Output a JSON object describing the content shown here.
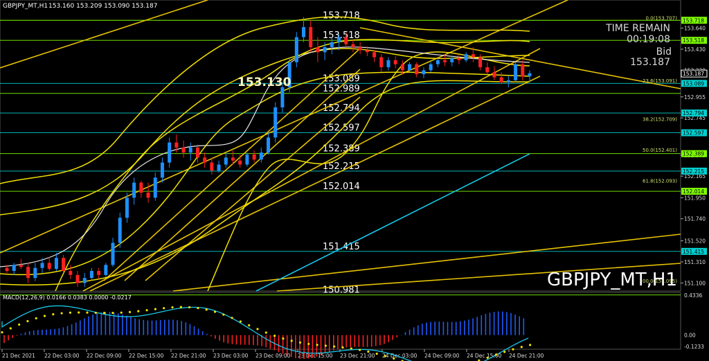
{
  "header": {
    "symbol_info": "GBPJPY_MT,H1",
    "ohlc": "153.160 153.209 153.090 153.187"
  },
  "watermark": "GBPJPY_MT,H1",
  "timer": {
    "label": "TIME REMAIN",
    "value": "00:19:08"
  },
  "bid": {
    "label": "Bid",
    "value": "153.187"
  },
  "high_label": "153.130",
  "h_levels": [
    {
      "value": "153.718",
      "color": "#7fff00"
    },
    {
      "value": "153.518",
      "color": "#7fff00"
    },
    {
      "value": "153.089",
      "color": "#00d0d0"
    },
    {
      "value": "152.989",
      "color": "#7fff00"
    },
    {
      "value": "152.794",
      "color": "#00d0d0"
    },
    {
      "value": "152.597",
      "color": "#00d0d0"
    },
    {
      "value": "152.389",
      "color": "#7fff00"
    },
    {
      "value": "152.215",
      "color": "#00d0d0"
    },
    {
      "value": "152.014",
      "color": "#7fff00"
    },
    {
      "value": "151.415",
      "color": "#00d0d0"
    },
    {
      "value": "150.981",
      "color": "#7fff00"
    }
  ],
  "fib_labels": [
    {
      "label": "0.0(153.707)",
      "price": 153.718
    },
    {
      "label": "23.6(153.091)",
      "price": 153.091
    },
    {
      "label": "38.2(152.709)",
      "price": 152.709
    },
    {
      "label": "50.0(152.401)",
      "price": 152.401
    },
    {
      "label": "61.8(152.093)",
      "price": 152.093
    },
    {
      "label": "100.0(151.095)",
      "price": 151.095
    }
  ],
  "price_axis": {
    "ticks": [
      "153.640",
      "153.430",
      "153.220",
      "152.955",
      "152.745",
      "152.375",
      "152.165",
      "151.950",
      "151.740",
      "151.520",
      "151.310",
      "151.100"
    ],
    "tick_values": [
      153.64,
      153.43,
      153.22,
      152.955,
      152.745,
      152.375,
      152.165,
      151.95,
      151.74,
      151.52,
      151.31,
      151.1
    ],
    "boxed": [
      {
        "label": "153.718",
        "color": "#7fff00"
      },
      {
        "label": "153.518",
        "color": "#7fff00"
      },
      {
        "label": "153.187",
        "color": "#ffffff"
      },
      {
        "label": "153.089",
        "color": "#00d0d0"
      },
      {
        "label": "152.794",
        "color": "#00d0d0"
      },
      {
        "label": "152.597",
        "color": "#00d0d0"
      },
      {
        "label": "152.389",
        "color": "#7fff00"
      },
      {
        "label": "152.215",
        "color": "#00d0d0"
      },
      {
        "label": "152.014",
        "color": "#7fff00"
      },
      {
        "label": "151.415",
        "color": "#00d0d0"
      }
    ]
  },
  "time_axis": [
    "21 Dec 2021",
    "22 Dec 03:00",
    "22 Dec 09:00",
    "22 Dec 15:00",
    "22 Dec 21:00",
    "23 Dec 03:00",
    "23 Dec 09:00",
    "23 Dec 15:00",
    "23 Dec 21:00",
    "24 Dec 03:00",
    "24 Dec 09:00",
    "24 Dec 15:00",
    "24 Dec 21:00"
  ],
  "macd": {
    "label": "MACD(12,26,9) 0.0166 0.0383 0.0000 -0.0217",
    "ticks": [
      "0.4336",
      "0.00",
      "-0.1233"
    ],
    "tick_values": [
      0.4336,
      0.0,
      -0.1233
    ]
  },
  "chart_data": {
    "type": "candlestick",
    "title": "GBPJPY_MT,H1",
    "ylim": [
      151.02,
      153.92
    ],
    "candles": [
      [
        151.25,
        151.28,
        151.2,
        151.22
      ],
      [
        151.22,
        151.3,
        151.18,
        151.28
      ],
      [
        151.28,
        151.34,
        151.24,
        151.26
      ],
      [
        151.26,
        151.3,
        151.1,
        151.15
      ],
      [
        151.15,
        151.3,
        151.12,
        151.25
      ],
      [
        151.25,
        151.35,
        151.2,
        151.3
      ],
      [
        151.3,
        151.36,
        151.22,
        151.24
      ],
      [
        151.24,
        151.4,
        151.22,
        151.35
      ],
      [
        151.35,
        151.38,
        151.2,
        151.22
      ],
      [
        151.22,
        151.28,
        151.14,
        151.18
      ],
      [
        151.18,
        151.22,
        151.06,
        151.1
      ],
      [
        151.1,
        151.2,
        151.06,
        151.15
      ],
      [
        151.15,
        151.25,
        151.12,
        151.22
      ],
      [
        151.22,
        151.25,
        151.14,
        151.18
      ],
      [
        151.18,
        151.3,
        151.16,
        151.28
      ],
      [
        151.28,
        151.55,
        151.26,
        151.5
      ],
      [
        151.5,
        151.8,
        151.45,
        151.75
      ],
      [
        151.75,
        152.0,
        151.7,
        151.95
      ],
      [
        151.95,
        152.15,
        151.88,
        152.1
      ],
      [
        152.1,
        152.12,
        151.95,
        152.0
      ],
      [
        152.0,
        152.1,
        151.9,
        151.95
      ],
      [
        151.95,
        152.2,
        151.92,
        152.15
      ],
      [
        152.15,
        152.35,
        152.1,
        152.3
      ],
      [
        152.3,
        152.55,
        152.25,
        152.5
      ],
      [
        152.5,
        152.58,
        152.4,
        152.45
      ],
      [
        152.45,
        152.52,
        152.35,
        152.4
      ],
      [
        152.4,
        152.5,
        152.32,
        152.45
      ],
      [
        152.45,
        152.48,
        152.3,
        152.35
      ],
      [
        152.35,
        152.4,
        152.25,
        152.3
      ],
      [
        152.3,
        152.35,
        152.18,
        152.22
      ],
      [
        152.22,
        152.32,
        152.2,
        152.28
      ],
      [
        152.28,
        152.4,
        152.25,
        152.35
      ],
      [
        152.35,
        152.42,
        152.28,
        152.32
      ],
      [
        152.32,
        152.38,
        152.25,
        152.28
      ],
      [
        152.28,
        152.4,
        152.26,
        152.38
      ],
      [
        152.38,
        152.42,
        152.3,
        152.33
      ],
      [
        152.33,
        152.45,
        152.3,
        152.4
      ],
      [
        152.4,
        152.6,
        152.38,
        152.55
      ],
      [
        152.55,
        152.9,
        152.5,
        152.85
      ],
      [
        152.85,
        153.1,
        152.8,
        153.05
      ],
      [
        153.05,
        153.35,
        153.0,
        153.3
      ],
      [
        153.3,
        153.6,
        153.25,
        153.55
      ],
      [
        153.55,
        153.75,
        153.5,
        153.65
      ],
      [
        153.65,
        153.72,
        153.4,
        153.45
      ],
      [
        153.45,
        153.55,
        153.3,
        153.4
      ],
      [
        153.4,
        153.5,
        153.32,
        153.45
      ],
      [
        153.45,
        153.55,
        153.38,
        153.5
      ],
      [
        153.5,
        153.58,
        153.42,
        153.55
      ],
      [
        153.55,
        153.6,
        153.45,
        153.48
      ],
      [
        153.48,
        153.52,
        153.4,
        153.45
      ],
      [
        153.45,
        153.5,
        153.38,
        153.42
      ],
      [
        153.42,
        153.46,
        153.36,
        153.4
      ],
      [
        153.4,
        153.42,
        153.3,
        153.35
      ],
      [
        153.35,
        153.38,
        153.2,
        153.25
      ],
      [
        153.25,
        153.35,
        153.22,
        153.32
      ],
      [
        153.32,
        153.36,
        153.24,
        153.28
      ],
      [
        153.28,
        153.32,
        153.18,
        153.22
      ],
      [
        153.22,
        153.3,
        153.2,
        153.28
      ],
      [
        153.28,
        153.3,
        153.15,
        153.18
      ],
      [
        153.18,
        153.25,
        153.14,
        153.22
      ],
      [
        153.22,
        153.3,
        153.2,
        153.28
      ],
      [
        153.28,
        153.34,
        153.25,
        153.32
      ],
      [
        153.32,
        153.38,
        153.26,
        153.3
      ],
      [
        153.3,
        153.36,
        153.26,
        153.34
      ],
      [
        153.34,
        153.38,
        153.28,
        153.32
      ],
      [
        153.32,
        153.4,
        153.3,
        153.38
      ],
      [
        153.38,
        153.45,
        153.3,
        153.35
      ],
      [
        153.35,
        153.38,
        153.22,
        153.25
      ],
      [
        153.25,
        153.3,
        153.18,
        153.2
      ],
      [
        153.2,
        153.26,
        153.12,
        153.15
      ],
      [
        153.15,
        153.2,
        153.08,
        153.1
      ],
      [
        153.1,
        153.16,
        153.05,
        153.12
      ],
      [
        153.12,
        153.3,
        153.1,
        153.28
      ],
      [
        153.28,
        153.32,
        153.12,
        153.16
      ],
      [
        153.16,
        153.22,
        153.1,
        153.19
      ]
    ]
  }
}
